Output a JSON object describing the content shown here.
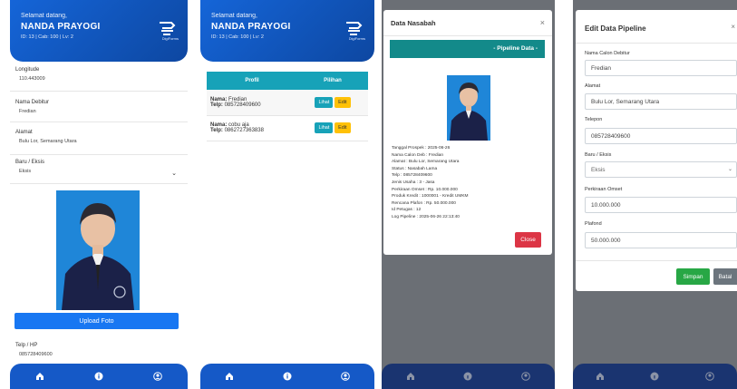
{
  "header": {
    "welcome": "Selamat datang,",
    "user_name": "NANDA PRAYOGI",
    "meta": "ID: 13 | Cab: 100 | Lv: 2",
    "logo_text": "DigiForms"
  },
  "form": {
    "longitude_label": "Longitude",
    "longitude_value": "110.443009",
    "nama_label": "Nama Debitur",
    "nama_value": "Fredian",
    "alamat_label": "Alamat",
    "alamat_value": "Bulu Lor, Semarang Utara",
    "baru_label": "Baru / Eksis",
    "baru_value": "Eksis",
    "upload_label": "Upload Foto",
    "telp_label": "Telp / HP",
    "telp_value": "085728409600"
  },
  "table": {
    "headers": [
      "Profil",
      "Pilihan"
    ],
    "rows": [
      {
        "nama_label": "Nama:",
        "nama": "Fredian",
        "telp_label": "Telp:",
        "telp": "085728409600",
        "btn_lihat": "Lihat",
        "btn_edit": "Edit"
      },
      {
        "nama_label": "Nama:",
        "nama": "cobu aja",
        "telp_label": "Telp:",
        "telp": "0862727363838",
        "btn_lihat": "Lihat",
        "btn_edit": "Edit"
      }
    ]
  },
  "modal_nasabah": {
    "title": "Data Nasabah",
    "close_x": "×",
    "banner": "- Pipeline Data -",
    "info": [
      "Tanggal Prospek : 2025-06-26",
      "Nama Calon Deb : Fredian",
      "Alamat : Bulu Lor, Semarang Utara",
      "Status : Nasabah Lama",
      "Telp : 085728409600",
      "Jenis Usaha : 3 - Jasa",
      "Perkiraan Omset : Rp. 10.000.000",
      "Produk Kredit : 1000001 - Kredit UMKM",
      "Rencana Plafon : Rp. 50.000.000",
      "Id Petugas : 12",
      "Log Pipeline : 2025-06-26 22:13:40"
    ],
    "close_button": "Close"
  },
  "modal_edit": {
    "title": "Edit Data Pipeline",
    "close_x": "×",
    "fields": [
      {
        "label": "Nama Calon Debitur",
        "value": "Fredian"
      },
      {
        "label": "Alamat",
        "value": "Bulu Lor, Semarang Utara"
      },
      {
        "label": "Telepon",
        "value": "085728409600"
      },
      {
        "label": "Baru / Eksis",
        "value": "Eksis"
      },
      {
        "label": "Perkiraan Omset",
        "value": "10.000.000"
      },
      {
        "label": "Plafond",
        "value": "50.000.000"
      }
    ],
    "save_button": "Simpan",
    "cancel_button": "Batal"
  },
  "nav_icons": [
    "home-icon",
    "info-icon",
    "user-icon"
  ],
  "colors": {
    "primary": "#1565d8",
    "teal": "#17a2b8",
    "warning": "#ffc107",
    "danger": "#dc3545",
    "success": "#28a745",
    "secondary": "#6c757d"
  }
}
